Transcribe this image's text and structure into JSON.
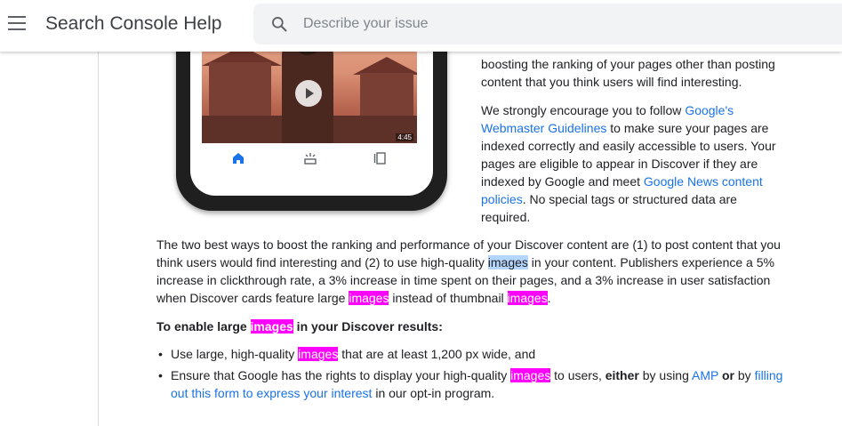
{
  "header": {
    "title": "Search Console Help",
    "search_placeholder": "Describe your issue"
  },
  "phone": {
    "video_duration": "4:45"
  },
  "para1": {
    "text": "boosting the ranking of your pages other than posting content that you think users will find interesting."
  },
  "para2": {
    "t1": "We strongly encourage you to follow ",
    "link1": "Google's Webmaster Guidelines",
    "t2": " to make sure your pages are indexed correctly and easily accessible to users. Your pages are eligible to appear in Discover if they are indexed by Google and meet ",
    "link2": "Google News content policies",
    "t3": ". No special tags or structured data are required."
  },
  "para3": {
    "t1": "The two best ways to boost the ranking and performance of your Discover content are (1) to post content that you think users would find interesting and (2) to use high-quality ",
    "sel": "images",
    "t2": " in your content. Publishers experience a 5% increase in clickthrough rate, a 3% increase in time spent on their pages, and a 3% increase in user satisfaction when Discover cards feature large ",
    "hl1": "images",
    "t3": " instead of thumbnail ",
    "hl2": "images",
    "t4": "."
  },
  "subhead": {
    "t1": "To enable large ",
    "hl": "images",
    "t2": " in your Discover results:"
  },
  "list": {
    "item1": {
      "t1": "Use large, high-quality ",
      "hl": "images",
      "t2": " that are at least 1,200 px wide, and"
    },
    "item2": {
      "t1": "Ensure that Google has the rights to display your high-quality ",
      "hl": "images",
      "t2": " to users, ",
      "b1": "either",
      "t3": " by using ",
      "link1": "AMP",
      "t4": " ",
      "b2": "or",
      "t5": " by ",
      "link2": "filling out this form to express your interest",
      "t6": " in our opt-in program."
    }
  },
  "colors": {
    "highlight": "#ff00ff",
    "link": "#1a73e8",
    "selection": "#b4d5fe"
  }
}
